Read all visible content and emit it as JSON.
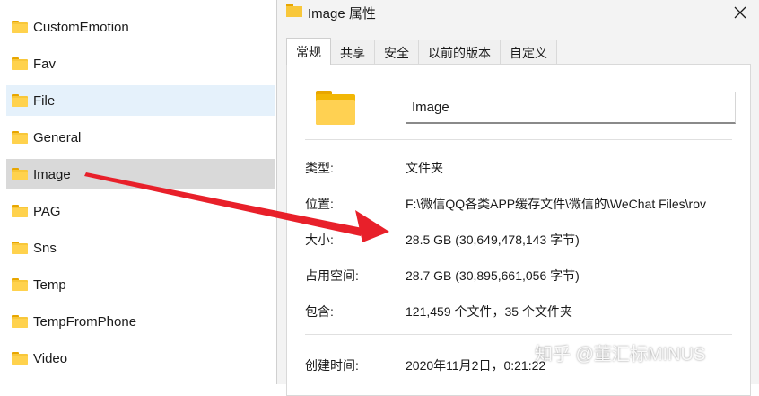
{
  "folders": [
    {
      "name": "CustomEmotion",
      "state": ""
    },
    {
      "name": "Fav",
      "state": ""
    },
    {
      "name": "File",
      "state": "hover"
    },
    {
      "name": "General",
      "state": ""
    },
    {
      "name": "Image",
      "state": "selected"
    },
    {
      "name": "PAG",
      "state": ""
    },
    {
      "name": "Sns",
      "state": ""
    },
    {
      "name": "Temp",
      "state": ""
    },
    {
      "name": "TempFromPhone",
      "state": ""
    },
    {
      "name": "Video",
      "state": ""
    }
  ],
  "dialog": {
    "title": "Image 属性",
    "tabs": [
      "常规",
      "共享",
      "安全",
      "以前的版本",
      "自定义"
    ],
    "active_tab": "常规",
    "name_value": "Image",
    "properties": [
      {
        "label": "类型:",
        "value": "文件夹"
      },
      {
        "label": "位置:",
        "value": "F:\\微信QQ各类APP缓存文件\\微信的\\WeChat Files\\rov"
      },
      {
        "label": "大小:",
        "value": "28.5 GB (30,649,478,143 字节)"
      },
      {
        "label": "占用空间:",
        "value": "28.7 GB (30,895,661,056 字节)"
      },
      {
        "label": "包含:",
        "value": "121,459 个文件，35 个文件夹"
      },
      {
        "label": "创建时间:",
        "value": "2020年11月2日，0:21:22"
      }
    ]
  },
  "watermark": "知乎 @董汇标MINUS",
  "colors": {
    "arrow": "#e8202a",
    "folder_yellow": "#f8c73a",
    "selected_bg": "#d9d9d9",
    "hover_bg": "#e5f1fb",
    "dialog_bg": "#f3f3f3"
  }
}
